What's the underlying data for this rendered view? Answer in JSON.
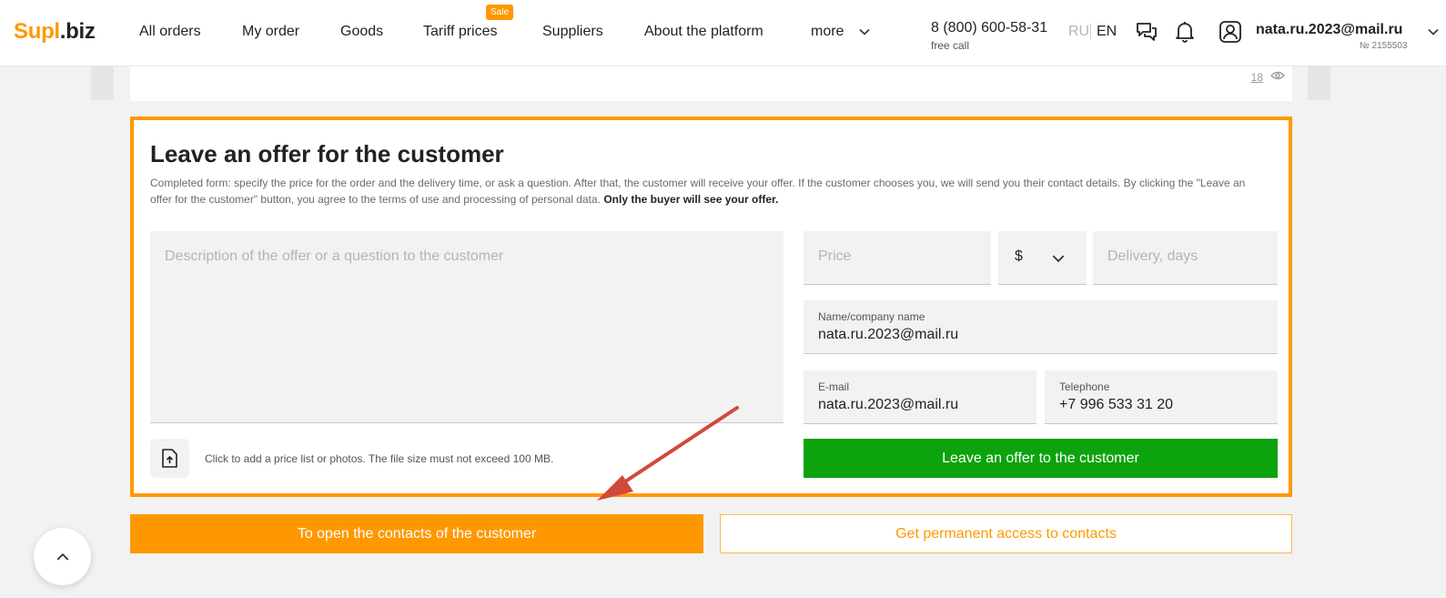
{
  "header": {
    "logo_part1": "Supl",
    "logo_part2": ".biz",
    "nav": [
      "All orders",
      "My order",
      "Goods",
      "Tariff prices",
      "Suppliers",
      "About the platform",
      "more"
    ],
    "sale_badge": "Sale",
    "phone": "8 (800) 600-58-31",
    "phone_note": "free call",
    "lang_ru": "RU",
    "lang_en": "EN",
    "user_email": "nata.ru.2023@mail.ru",
    "user_id": "№ 2155503",
    "icons": [
      "chat-icon",
      "bell-icon",
      "user-icon",
      "chevron-down-icon"
    ]
  },
  "top_card": {
    "views": "18"
  },
  "offer": {
    "title": "Leave an offer for the customer",
    "desc": "Completed form: specify the price for the order and the delivery time, or ask a question. After that, the customer will receive your offer. If the customer chooses you, we will send you their contact details. By clicking the \"Leave an offer for the customer\" button, you agree to the terms of use and processing of personal data.",
    "desc_bold": "Only the buyer will see your offer.",
    "textarea_placeholder": "Description of the offer or a question to the customer",
    "price_placeholder": "Price",
    "currency": "$",
    "delivery_placeholder": "Delivery, days",
    "company_label": "Name/company name",
    "company_value": "nata.ru.2023@mail.ru",
    "email_label": "E-mail",
    "email_value": "nata.ru.2023@mail.ru",
    "tel_label": "Telephone",
    "tel_value": "+7 996 533 31 20",
    "attach_text": "Click to add a price list or photos. The file size must not exceed 100 MB.",
    "submit_label": "Leave an offer to the customer"
  },
  "actions": {
    "open_contacts": "To open the contacts of the customer",
    "permanent_access": "Get permanent access to contacts"
  },
  "colors": {
    "accent": "#ff9800",
    "success": "#0ca30c",
    "annotation_arrow": "#d0493b"
  }
}
